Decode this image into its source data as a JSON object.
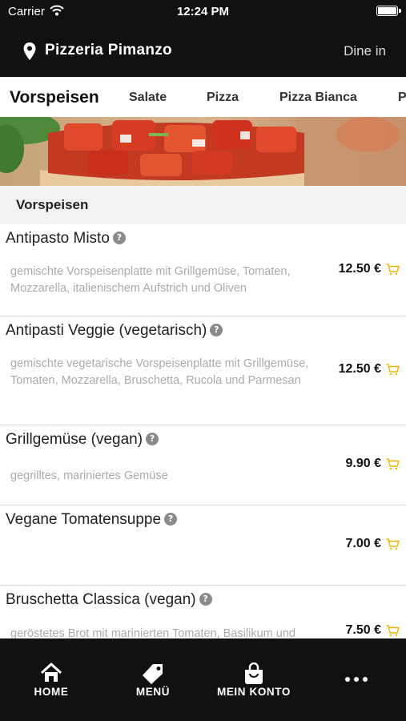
{
  "status_bar": {
    "carrier": "Carrier",
    "time": "12:24 PM"
  },
  "header": {
    "restaurant_name": "Pizzeria Pimanzo",
    "dine_mode": "Dine in"
  },
  "tabs": [
    {
      "label": "Vorspeisen",
      "active": true
    },
    {
      "label": "Salate"
    },
    {
      "label": "Pizza"
    },
    {
      "label": "Pizza Bianca"
    },
    {
      "label": "P"
    }
  ],
  "section_title": "Vorspeisen",
  "items": [
    {
      "name": "Antipasto Misto",
      "description": "gemischte Vorspeisenplatte mit Grillgemüse, Tomaten, Mozzarella, italienischem Aufstrich und Oliven",
      "price": "12.50 €"
    },
    {
      "name": "Antipasti Veggie (vegetarisch)",
      "description": "gemischte vegetarische Vorspeisenplatte mit Grillgemüse, Tomaten, Mozzarella, Bruschetta, Rucola und Parmesan",
      "price": "12.50 €"
    },
    {
      "name": "Grillgemüse (vegan)",
      "description": "gegrilltes, mariniertes Gemüse",
      "price": "9.90 €"
    },
    {
      "name": "Vegane Tomatensuppe",
      "description": "",
      "price": "7.00 €"
    },
    {
      "name": "Bruschetta Classica (vegan)",
      "description": "geröstetes Brot mit marinierten Tomaten, Basilikum und",
      "price": "7.50 €"
    }
  ],
  "bottom_nav": [
    {
      "label": "HOME",
      "icon": "home-icon"
    },
    {
      "label": "MENÜ",
      "icon": "tag-icon"
    },
    {
      "label": "MEIN KONTO",
      "icon": "shopping-bag-icon"
    },
    {
      "label": "",
      "icon": "more-icon"
    }
  ],
  "colors": {
    "bar_bg": "#111111",
    "cart_accent": "#f0b400",
    "section_bg": "#f2f2f2",
    "description_text": "#aaaaaa"
  }
}
